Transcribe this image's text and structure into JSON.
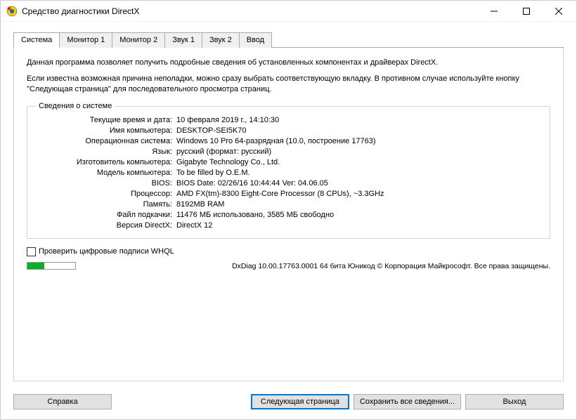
{
  "window": {
    "title": "Средство диагностики DirectX"
  },
  "tabs": [
    {
      "label": "Система",
      "active": true
    },
    {
      "label": "Монитор 1",
      "active": false
    },
    {
      "label": "Монитор 2",
      "active": false
    },
    {
      "label": "Звук 1",
      "active": false
    },
    {
      "label": "Звук 2",
      "active": false
    },
    {
      "label": "Ввод",
      "active": false
    }
  ],
  "intro": {
    "line1": "Данная программа позволяет получить подробные сведения об установленных компонентах и драйверах DirectX.",
    "line2": "Если известна возможная причина неполадки, можно сразу выбрать соответствующую вкладку. В противном случае используйте кнопку \"Следующая страница\" для последовательного просмотра страниц."
  },
  "system_info": {
    "legend": "Сведения о системе",
    "rows": [
      {
        "label": "Текущие время и дата:",
        "value": "10 февраля 2019 г., 14:10:30"
      },
      {
        "label": "Имя компьютера:",
        "value": "DESKTOP-SEI5K70"
      },
      {
        "label": "Операционная система:",
        "value": "Windows 10 Pro 64-разрядная (10.0, построение 17763)"
      },
      {
        "label": "Язык:",
        "value": "русский (формат: русский)"
      },
      {
        "label": "Изготовитель компьютера:",
        "value": "Gigabyte Technology Co., Ltd."
      },
      {
        "label": "Модель компьютера:",
        "value": "To be filled by O.E.M."
      },
      {
        "label": "BIOS:",
        "value": "BIOS Date: 02/26/16 10:44:44 Ver: 04.06.05"
      },
      {
        "label": "Процессор:",
        "value": "AMD FX(tm)-8300 Eight-Core Processor            (8 CPUs), ~3.3GHz"
      },
      {
        "label": "Память:",
        "value": "8192MB RAM"
      },
      {
        "label": "Файл подкачки:",
        "value": "11476 МБ использовано, 3585 МБ свободно"
      },
      {
        "label": "Версия DirectX:",
        "value": "DirectX 12"
      }
    ]
  },
  "checkbox": {
    "label": "Проверить цифровые подписи WHQL",
    "checked": false
  },
  "footer": {
    "version": "DxDiag 10.00.17763.0001 64 бита Юникод © Корпорация Майкрософт. Все права защищены."
  },
  "buttons": {
    "help": "Справка",
    "next": "Следующая страница",
    "save": "Сохранить все сведения...",
    "exit": "Выход"
  }
}
